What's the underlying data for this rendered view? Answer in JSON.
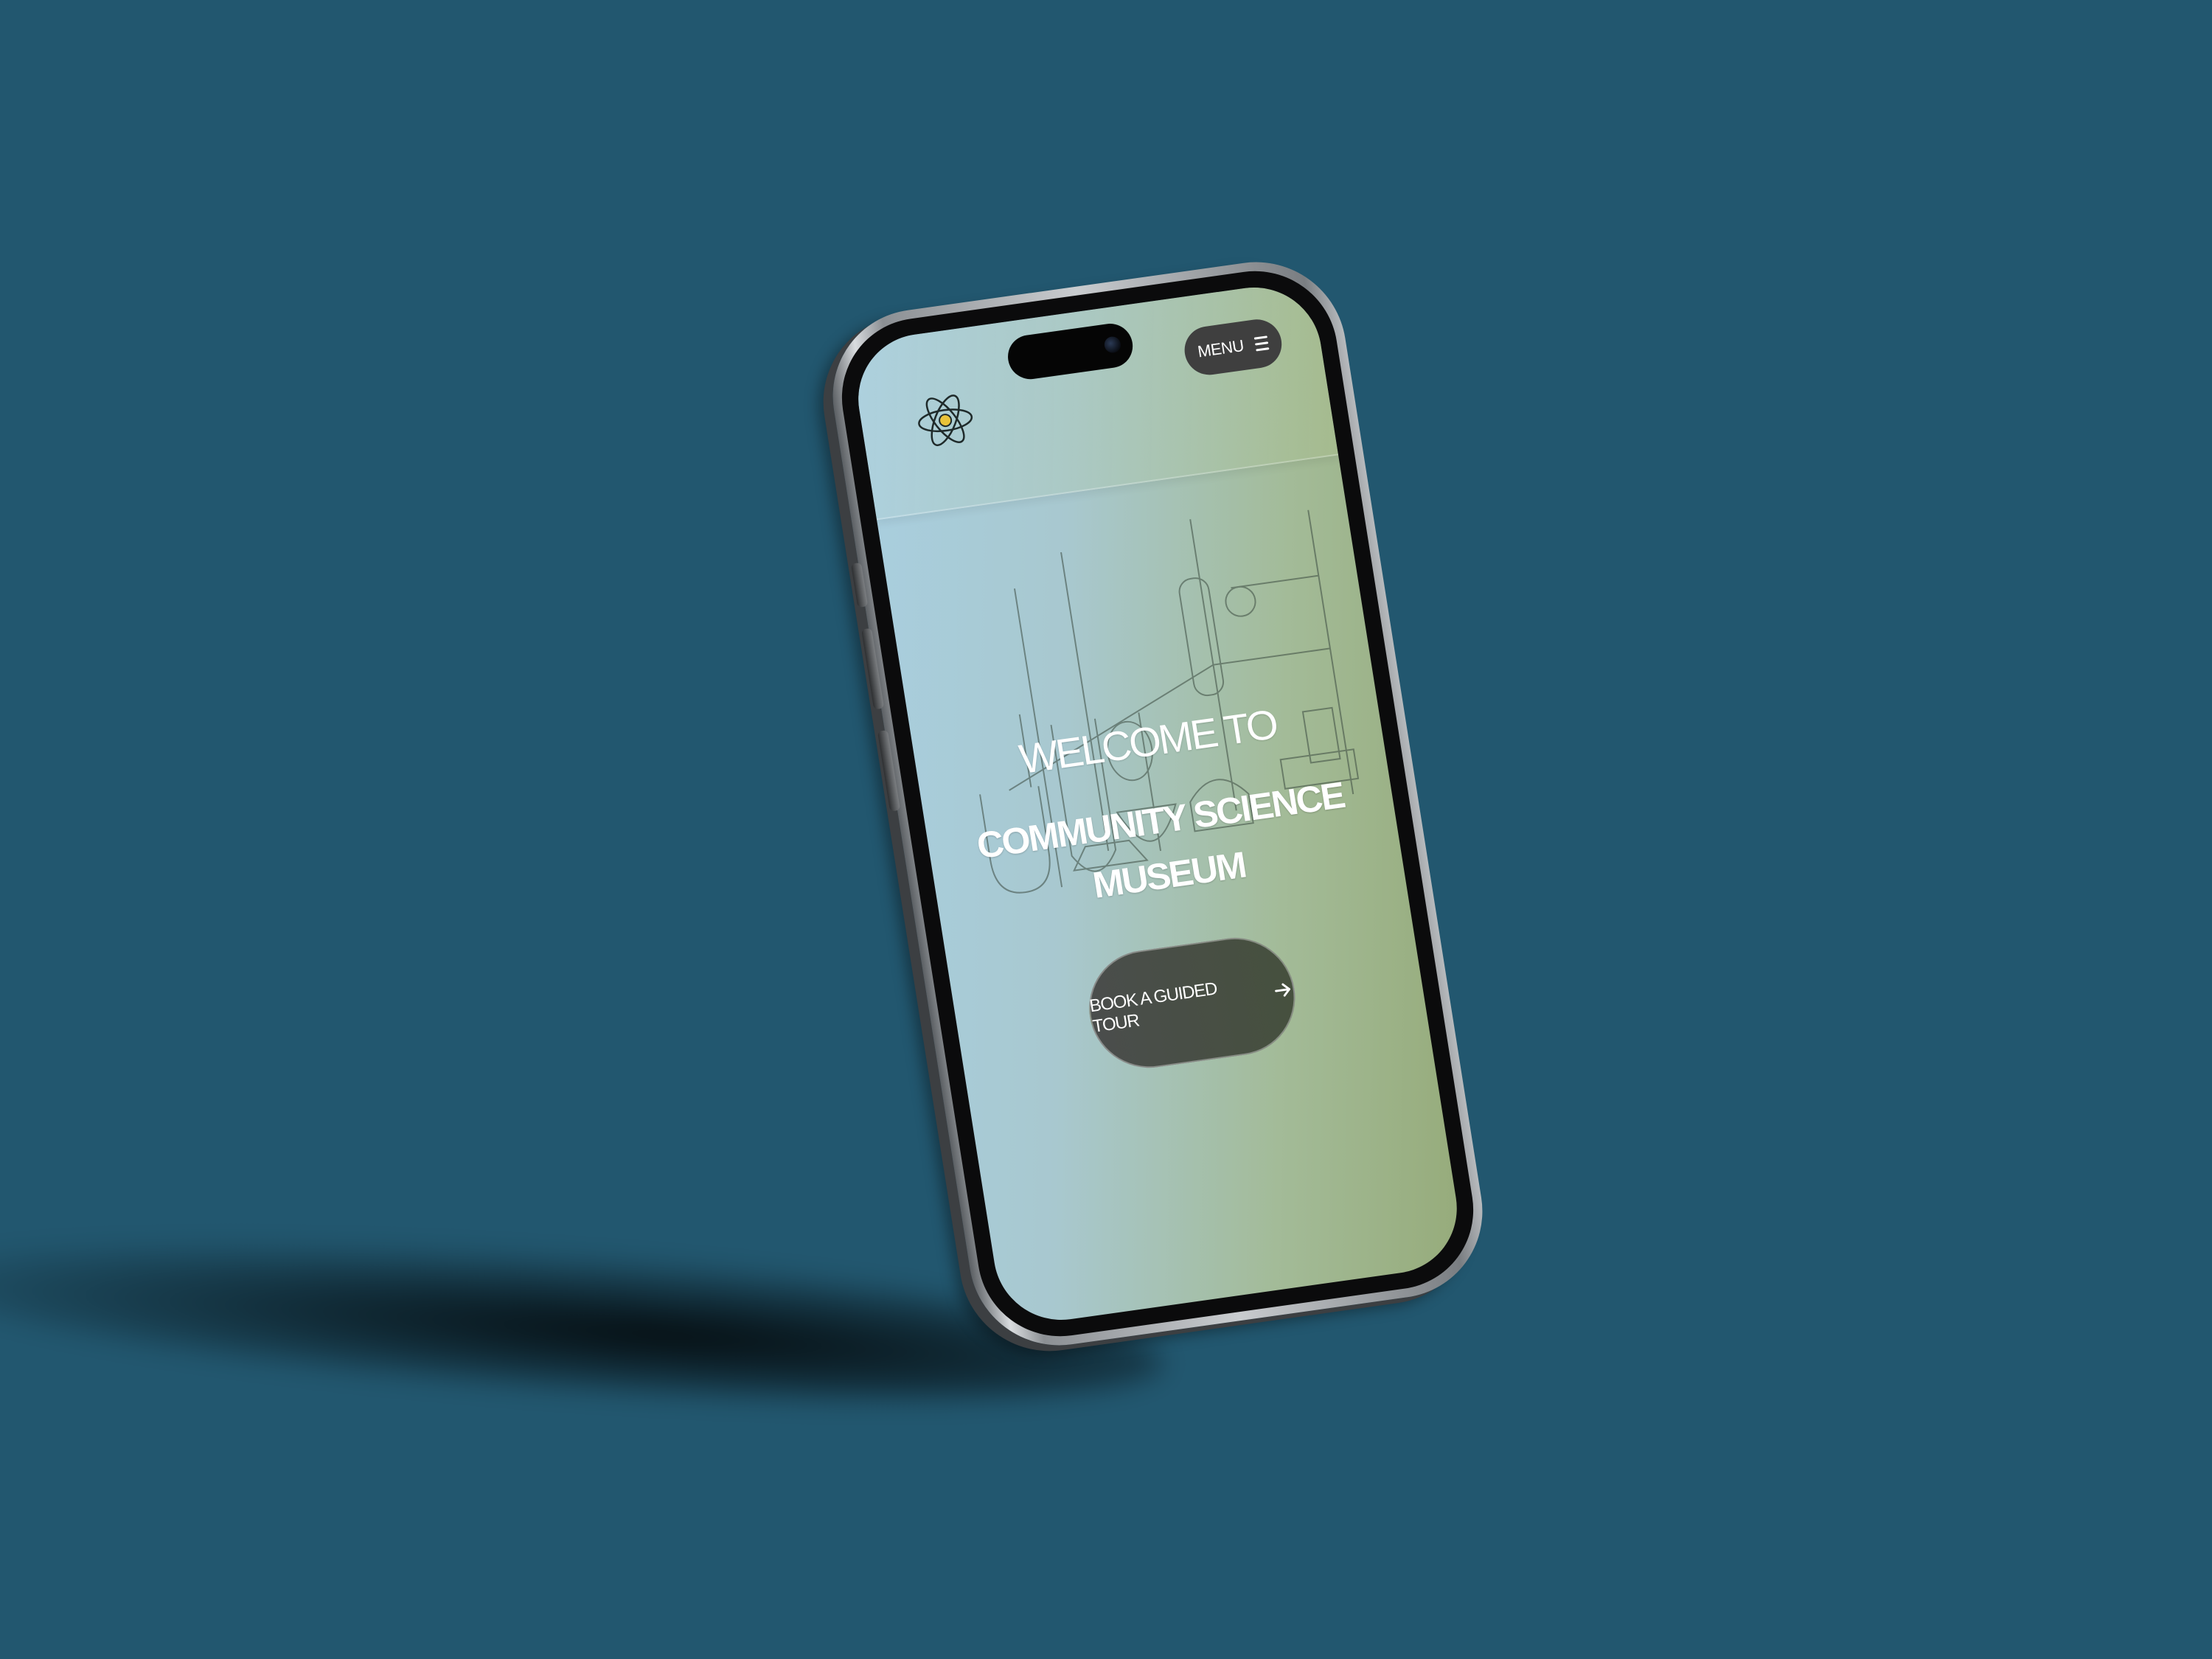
{
  "header": {
    "logo_icon": "atom-icon",
    "menu_label": "MENU",
    "menu_icon": "hamburger-menu-icon"
  },
  "hero": {
    "welcome": "WELCOME TO",
    "title_line1": "COMMUNITY SCIENCE",
    "title_line2": "MUSEUM",
    "background_art": "laboratory-glassware-illustration"
  },
  "cta": {
    "label": "BOOK A GUIDED TOUR",
    "icon": "arrow-right-icon"
  },
  "colors": {
    "page_background": "#22576f",
    "screen_gradient_start": "#a9cfe0",
    "screen_gradient_end": "#96ab7a",
    "button_dark": "#3f3f3f",
    "text": "#ffffff",
    "atom_nucleus": "#e9c33a"
  }
}
